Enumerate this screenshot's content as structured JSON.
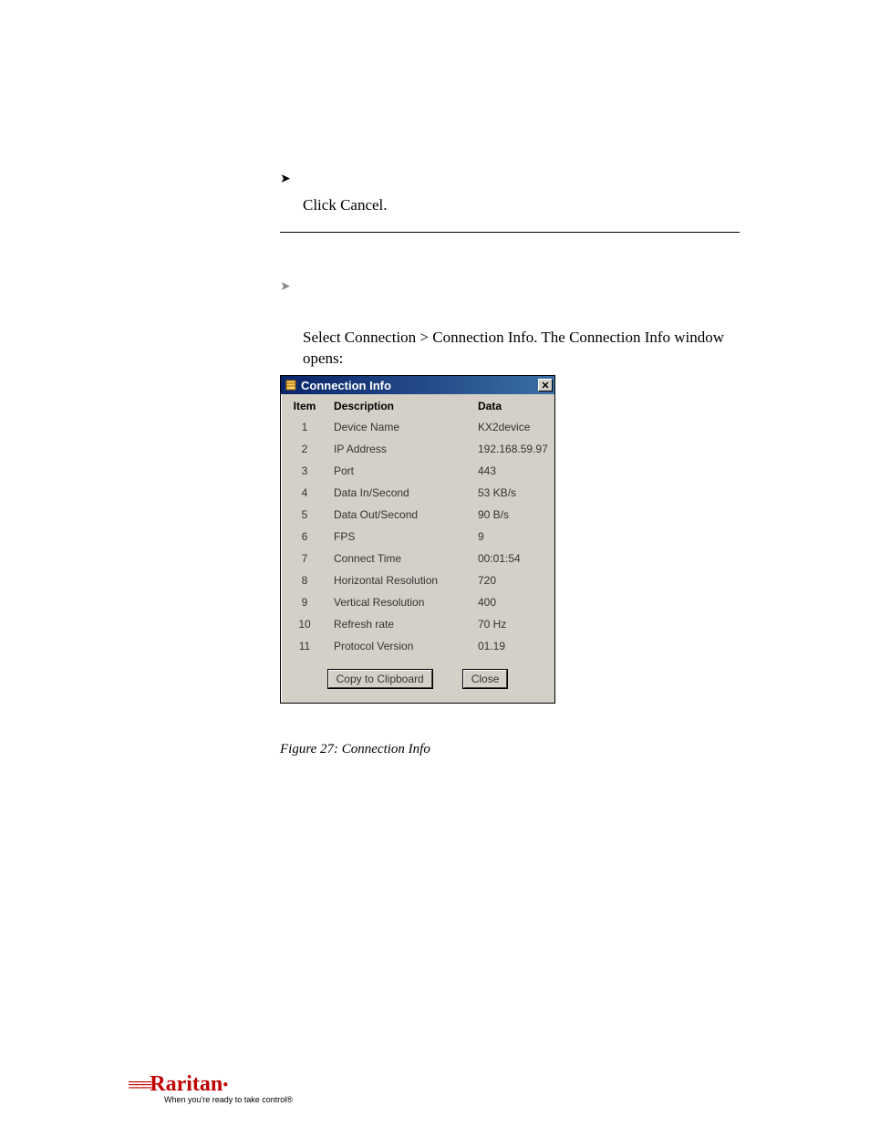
{
  "line1": "Click Cancel.",
  "line2a": "Select Connection > Connection Info. The Connection Info window",
  "line2b": "opens:",
  "caption": "Figure 27: Connection Info",
  "win": {
    "title": "Connection Info",
    "headers": {
      "item": "Item",
      "desc": "Description",
      "data": "Data"
    },
    "rows": [
      {
        "n": "1",
        "desc": "Device Name",
        "data": "KX2device"
      },
      {
        "n": "2",
        "desc": "IP Address",
        "data": "192.168.59.97"
      },
      {
        "n": "3",
        "desc": "Port",
        "data": "443"
      },
      {
        "n": "4",
        "desc": "Data In/Second",
        "data": "53 KB/s"
      },
      {
        "n": "5",
        "desc": "Data Out/Second",
        "data": "90 B/s"
      },
      {
        "n": "6",
        "desc": "FPS",
        "data": "9"
      },
      {
        "n": "7",
        "desc": "Connect Time",
        "data": "00:01:54"
      },
      {
        "n": "8",
        "desc": "Horizontal Resolution",
        "data": "720"
      },
      {
        "n": "9",
        "desc": "Vertical Resolution",
        "data": "400"
      },
      {
        "n": "10",
        "desc": "Refresh rate",
        "data": "70 Hz"
      },
      {
        "n": "11",
        "desc": "Protocol Version",
        "data": "01.19"
      }
    ],
    "buttons": {
      "copy": "Copy to Clipboard",
      "close": "Close"
    }
  },
  "logo": {
    "brand": "Raritan",
    "tagline": "When you're ready to take control®"
  }
}
